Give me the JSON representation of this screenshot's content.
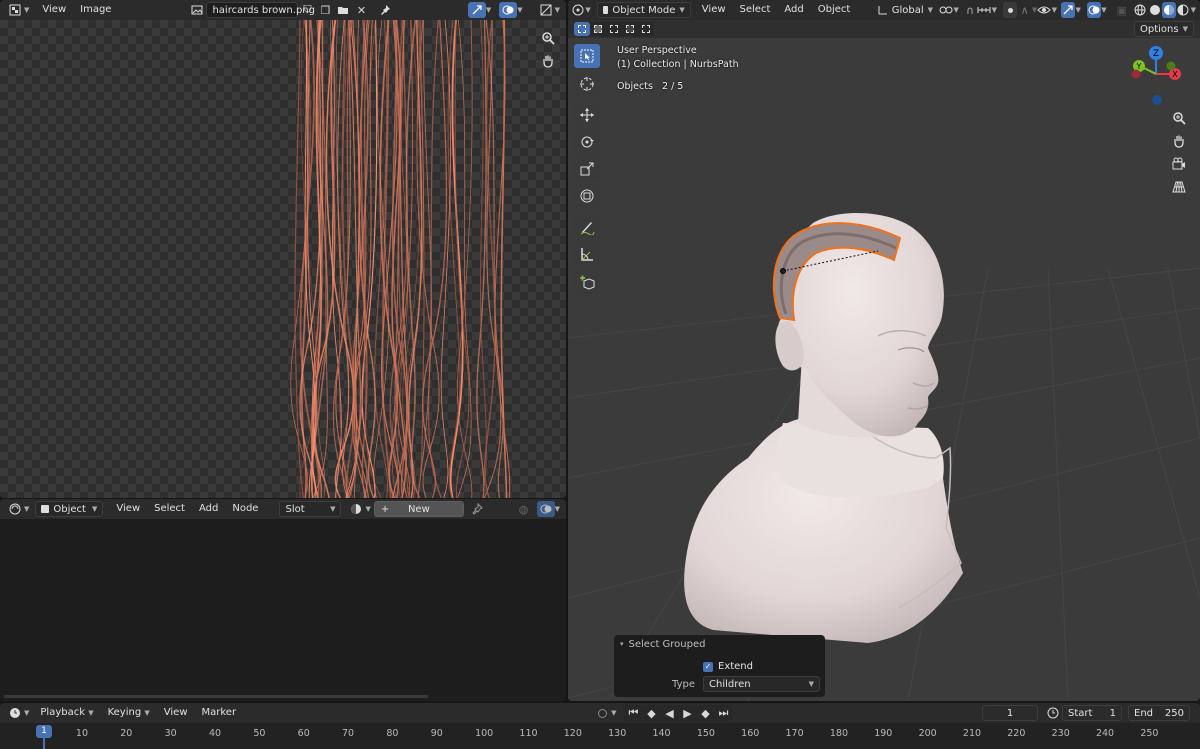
{
  "image_editor": {
    "menu": [
      "View",
      "Image"
    ],
    "image_name": "haircards brown.png"
  },
  "node_editor": {
    "mode": "Object",
    "menu": [
      "View",
      "Select",
      "Add",
      "Node"
    ],
    "slot": "Slot",
    "new_label": "New"
  },
  "viewport": {
    "mode": "Object Mode",
    "menu": [
      "View",
      "Select",
      "Add",
      "Object"
    ],
    "transform_orientation": "Global",
    "options_label": "Options",
    "info": {
      "perspective": "User Perspective",
      "collection": "(1) Collection | NurbsPath",
      "objects_label": "Objects",
      "objects_count": "2 / 5"
    },
    "gizmo_axes": [
      "Z",
      "Y",
      "X"
    ]
  },
  "operator_panel": {
    "title": "Select Grouped",
    "extend_label": "Extend",
    "extend_checked": true,
    "type_label": "Type",
    "type_value": "Children"
  },
  "timeline": {
    "menu": [
      "Playback",
      "Keying",
      "View",
      "Marker"
    ],
    "current_frame": "1",
    "start_label": "Start",
    "start_value": "1",
    "end_label": "End",
    "end_value": "250",
    "ruler": [
      "1",
      "10",
      "20",
      "30",
      "40",
      "50",
      "60",
      "70",
      "80",
      "90",
      "100",
      "110",
      "120",
      "130",
      "140",
      "150",
      "160",
      "170",
      "180",
      "190",
      "200",
      "210",
      "220",
      "230",
      "240",
      "250"
    ]
  },
  "colors": {
    "accent": "#4772b3",
    "selection_outline": "#f0721c",
    "hair": "#c98a6a",
    "skin": "#e6dcdc",
    "axis_x": "#e23b4a",
    "axis_y": "#7ec320",
    "axis_z": "#2f80e5"
  }
}
